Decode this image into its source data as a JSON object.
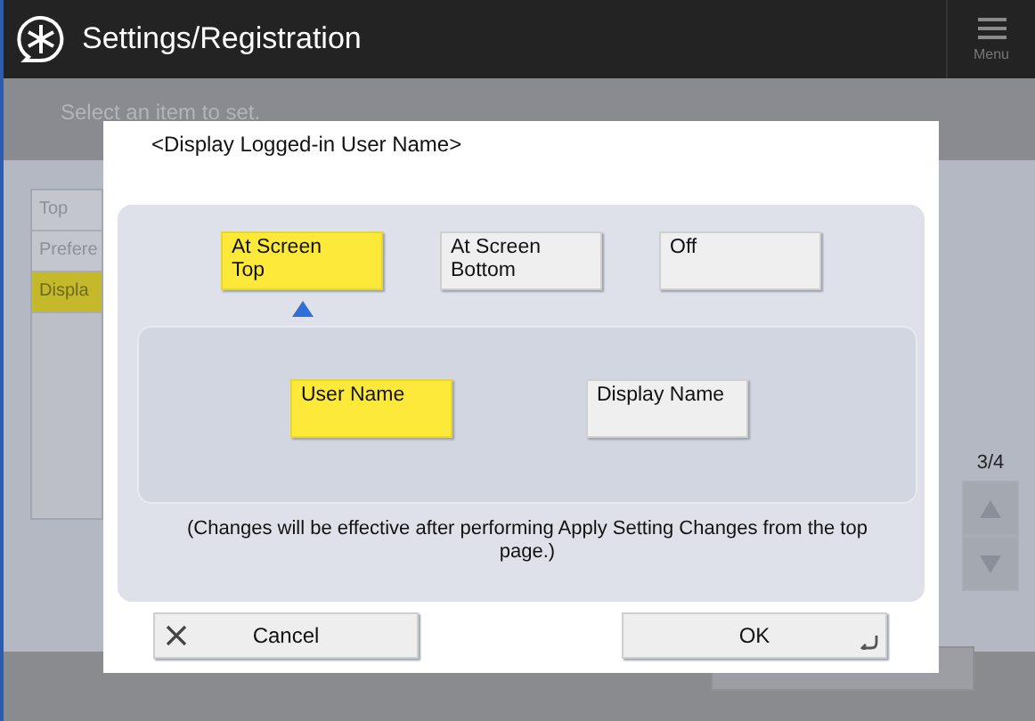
{
  "header": {
    "title": "Settings/Registration",
    "menu_label": "Menu"
  },
  "background": {
    "instruction": "Select an item to set.",
    "list": [
      {
        "label": "Top",
        "selected": false
      },
      {
        "label": "Prefere",
        "selected": false
      },
      {
        "label": "Displa",
        "selected": true
      }
    ],
    "page": "3/4"
  },
  "dialog": {
    "title": "<Display Logged-in User Name>",
    "positions": [
      {
        "label": "At Screen Top",
        "selected": true
      },
      {
        "label": "At Screen Bottom",
        "selected": false
      },
      {
        "label": "Off",
        "selected": false
      }
    ],
    "name_options": [
      {
        "label": "User Name",
        "selected": true
      },
      {
        "label": "Display Name",
        "selected": false
      }
    ],
    "note": "(Changes will be effective after performing Apply Setting Changes from the top page.)",
    "cancel": "Cancel",
    "ok": "OK"
  }
}
